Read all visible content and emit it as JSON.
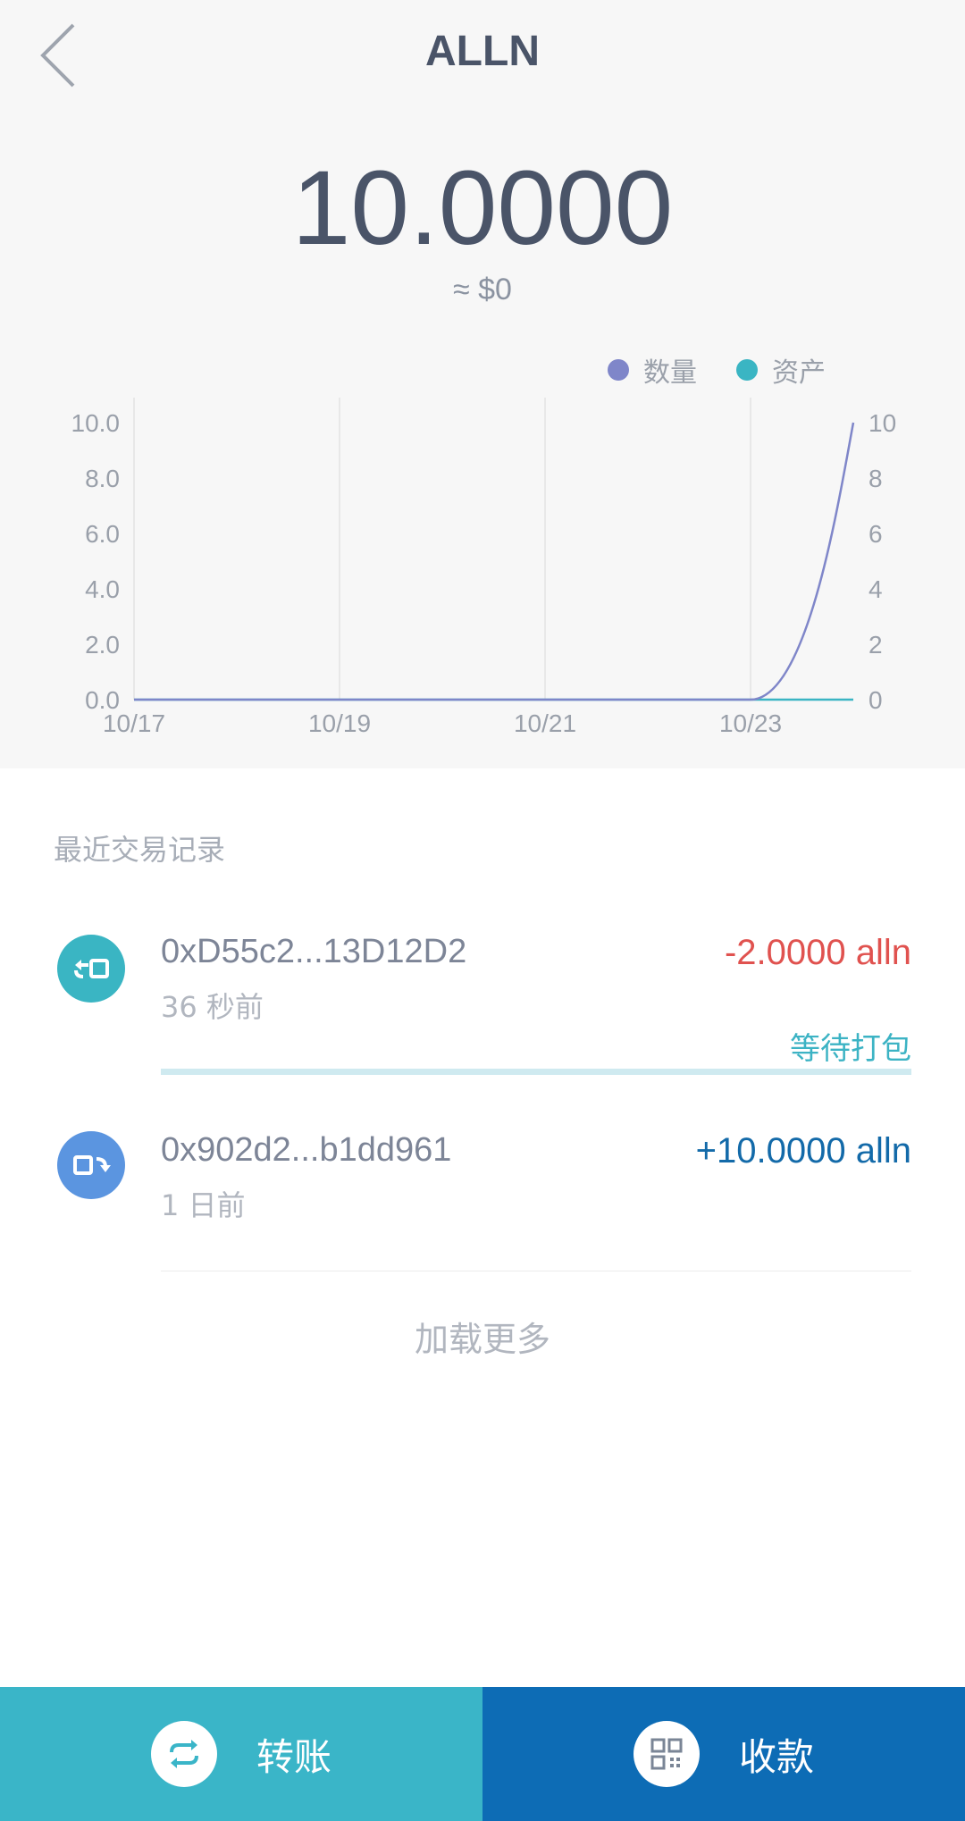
{
  "header": {
    "title": "ALLN",
    "back_icon": "chevron-left-icon"
  },
  "summary": {
    "balance": "10.0000",
    "fiat_value": "≈ $0"
  },
  "legend": [
    {
      "label": "数量",
      "color": "#7f86c9"
    },
    {
      "label": "资产",
      "color": "#3ab5c3"
    }
  ],
  "chart_data": {
    "type": "line",
    "x": [
      "10/17",
      "10/19",
      "10/21",
      "10/23"
    ],
    "y_left_ticks": [
      "10.0",
      "8.0",
      "6.0",
      "4.0",
      "2.0",
      "0.0"
    ],
    "y_right_ticks": [
      "10",
      "8",
      "6",
      "4",
      "2",
      "0"
    ],
    "ylim": [
      0,
      10
    ],
    "series": [
      {
        "name": "数量",
        "color": "#7f86c9",
        "points": [
          [
            "10/17",
            0
          ],
          [
            "10/19",
            0
          ],
          [
            "10/21",
            0
          ],
          [
            "10/23",
            0
          ],
          [
            "10/24",
            10
          ]
        ]
      },
      {
        "name": "资产",
        "color": "#3ab5c3",
        "points": [
          [
            "10/17",
            0
          ],
          [
            "10/19",
            0
          ],
          [
            "10/21",
            0
          ],
          [
            "10/23",
            0
          ],
          [
            "10/24",
            0
          ]
        ]
      }
    ],
    "grid": "vertical"
  },
  "transactions": {
    "title": "最近交易记录",
    "items": [
      {
        "address": "0xD55c2...13D12D2",
        "time": "36 秒前",
        "amount": "-2.0000 alln",
        "amount_color": "#e0524f",
        "status": "等待打包",
        "icon": "send-icon",
        "icon_color": "#3ab5c3"
      },
      {
        "address": "0x902d2...b1dd961",
        "time": "1 日前",
        "amount": "+10.0000 alln",
        "amount_color": "#136aa9",
        "icon": "receive-icon",
        "icon_color": "#5b95e0"
      }
    ],
    "load_more": "加载更多"
  },
  "actions": {
    "transfer": {
      "label": "转账",
      "icon": "transfer-icon",
      "color": "#3ab5c8"
    },
    "receive": {
      "label": "收款",
      "icon": "qr-code-icon",
      "color": "#0d6cb5"
    }
  }
}
